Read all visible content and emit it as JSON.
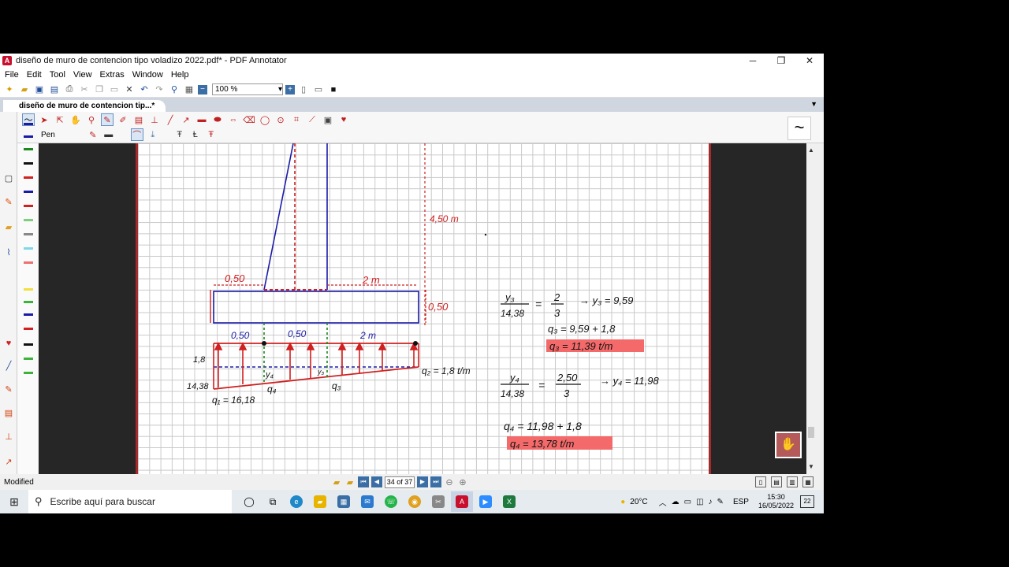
{
  "window": {
    "title": "diseño de muro de contencion tipo voladizo 2022.pdf* - PDF Annotator",
    "minimize": "─",
    "maximize": "❐",
    "close": "✕"
  },
  "menu": [
    "File",
    "Edit",
    "Tool",
    "View",
    "Extras",
    "Window",
    "Help"
  ],
  "toolbar": {
    "zoom_value": "100 %"
  },
  "tab": {
    "label": "diseño de muro de contencion tip...*"
  },
  "annotation_toolbar": {
    "tool_label": "Pen",
    "preview_glyph": "~"
  },
  "drawing": {
    "dim_height": "4,50 m",
    "dim_toe": "0,50",
    "dim_heel": "2 m",
    "dim_footing_thickness": "0,50",
    "dim_base_toe": "0,50",
    "dim_base_stem": "0,50",
    "dim_base_heel": "2 m",
    "q_top_left": "1,8",
    "q_diff": "14,38",
    "q1": "q₁ = 16,18",
    "q2": "q₂ = 1,8 t/m",
    "q3_label": "q₃",
    "q4_label": "q₄",
    "y3_label": "y₃",
    "y4_label": "y₄",
    "eq1_frac_num": "y₃",
    "eq1_frac_den": "14,38",
    "eq1_rhs_num": "2",
    "eq1_rhs_den": "3",
    "eq1_result": "→ y₃ = 9,59",
    "eq2": "q₃ = 9,59 + 1,8",
    "eq3": "q₃ = 11,39 t/m",
    "eq4_frac_num": "y₄",
    "eq4_frac_den": "14,38",
    "eq4_rhs_num": "2,50",
    "eq4_rhs_den": "3",
    "eq4_result": "→ y₄ = 11,98",
    "eq5": "q₄ = 11,98 + 1,8",
    "eq6": "q₄ = 13,78 t/m"
  },
  "status": {
    "text": "Modified",
    "page_indicator": "34 of 37"
  },
  "taskbar": {
    "search_placeholder": "Escribe aquí para buscar",
    "weather": "20°C",
    "language": "ESP",
    "time": "15:30",
    "date": "16/05/2022",
    "notifications": "22"
  },
  "colors": {
    "accent": "#3a6ea5",
    "annotation_red": "#e02020",
    "annotation_blue": "#1a1aa8",
    "highlight_red": "#f46a6a"
  }
}
